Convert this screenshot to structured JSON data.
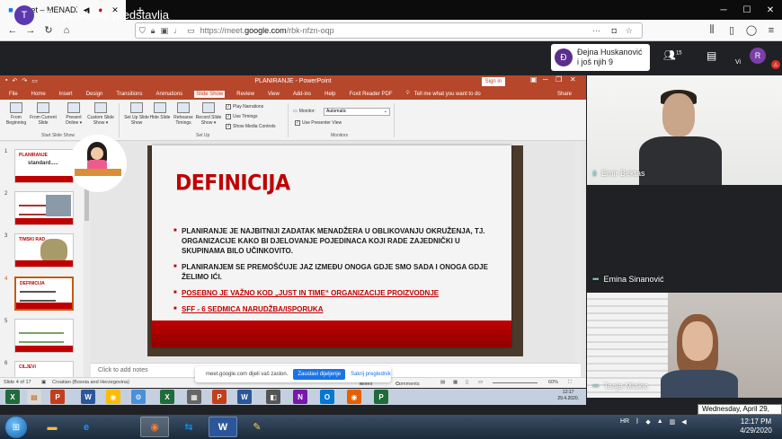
{
  "browser": {
    "tab_title": "Meet – MENADŽMENT - pr",
    "tab_icons": [
      "audio-icon",
      "camera-icon"
    ],
    "url_prefix": "https://meet.",
    "url_domain": "google.com",
    "url_path": "/rbk-nfzn-oqp"
  },
  "meet": {
    "presenter_initial": "T",
    "presenting_text": "Tanja Mlakic predstavlja",
    "self_initial": "Đ",
    "self_name_line1": "Đejna Huskanović",
    "self_name_line2": "i još njih 9",
    "people_count": "15",
    "vi_label": "Vi",
    "account_initial": "R"
  },
  "powerpoint": {
    "window_title": "PLANIRANJE - PowerPoint",
    "sign_in": "Sign in",
    "menus": [
      "File",
      "Home",
      "Insert",
      "Design",
      "Transitions",
      "Animations",
      "Slide Show",
      "Review",
      "View",
      "Add-ins",
      "Help",
      "Foxit Reader PDF",
      "Tell me what you want to do",
      "Share"
    ],
    "active_menu": "Slide Show",
    "ribbon": {
      "buttons": [
        {
          "label": "From Beginning"
        },
        {
          "label": "From Current Slide"
        },
        {
          "label": "Present Online ▾"
        },
        {
          "label": "Custom Slide Show ▾"
        },
        {
          "label": "Set Up Slide Show"
        },
        {
          "label": "Hide Slide"
        },
        {
          "label": "Rehearse Timings"
        },
        {
          "label": "Record Slide Show ▾"
        }
      ],
      "groups": [
        "Start Slide Show",
        "Set Up",
        "Monitors"
      ],
      "checks": [
        "Play Narrations",
        "Use Timings",
        "Show Media Controls",
        "Use Presenter View"
      ],
      "monitor_label": "Monitor:",
      "monitor_value": "Automatic"
    },
    "thumbnails": [
      {
        "num": "1",
        "title": "PLANIRANJE",
        "subtitle": "standard....."
      },
      {
        "num": "2",
        "title": ""
      },
      {
        "num": "3",
        "title": "TIMSKI RAD"
      },
      {
        "num": "4",
        "title": "DEFINICIJA"
      },
      {
        "num": "5",
        "title": ""
      },
      {
        "num": "6",
        "title": "CILJEVI"
      }
    ],
    "slide": {
      "title": "DEFINICIJA",
      "bullets": [
        "PLANIRANJE JE NAJBITNIJI ZADATAK MENADŽERA U OBLIKOVANJU OKRUŽENJA, TJ. ORGANIZACIJE KAKO BI DJELOVANJE POJEDINACA KOJI RADE ZAJEDNIČKI U SKUPINAMA BILO UČINKOVITO.",
        "PLANIRANJEM SE PREMOŠĆUJE JAZ IZMEĐU ONOGA GDJE SMO SADA I ONOGA GDJE ŽELIMO IĆI.",
        "POSEBNO JE VAŽNO KOD „JUST IN TIME“ ORGANIZACIJE PROIZVODNJE",
        "SFF - 6 SEDMICA NARUDŽBA/ISPORUKA"
      ]
    },
    "notes_placeholder": "Click to add notes",
    "status": {
      "slide_of": "Slide 4 of 17",
      "language": "Croatian (Bosnia and Herzegovina)",
      "notes": "Notes",
      "comments": "Comments",
      "zoom": "60%"
    },
    "inner_clock_time": "12:17",
    "inner_clock_date": "29.4.2020."
  },
  "share_banner": {
    "text": "meet.google.com dijeli vaš zaslon.",
    "stop_label": "Zaustavi dijeljenje",
    "hide_label": "Sakrij pregledník"
  },
  "participants": [
    {
      "name": "Emir Bektas"
    },
    {
      "name": "Emina Sinanović"
    },
    {
      "name": "Tanja Mlakic"
    }
  ],
  "tooltip_date": "Wednesday, April 29, 2020",
  "taskbar": {
    "apps": [
      "explorer-icon",
      "internet-explorer-icon",
      "firefox-icon",
      "teamviewer-icon",
      "word-icon",
      "paint-icon"
    ],
    "language": "HR",
    "time": "12:17 PM",
    "date": "4/29/2020"
  },
  "colors": {
    "ppt_accent": "#b7472a",
    "slide_red": "#c00000",
    "meet_bg": "#202124"
  }
}
